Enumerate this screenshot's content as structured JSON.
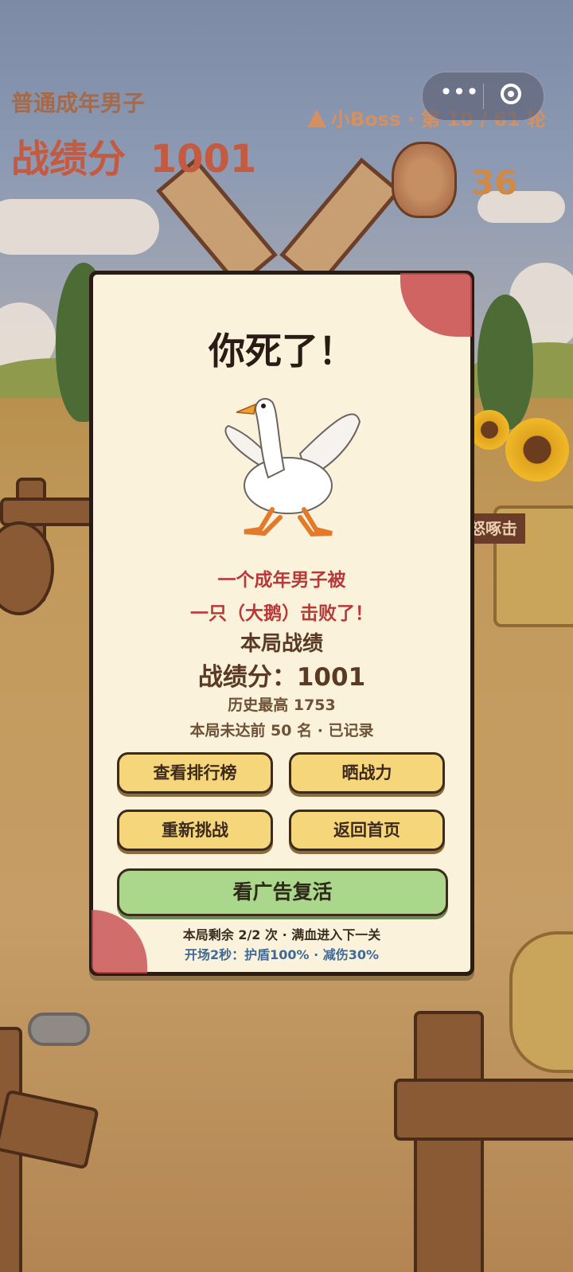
{
  "hud": {
    "player_title": "普通成年男子",
    "score_label": "战绩分",
    "score_value": "1001",
    "round_text": "小Boss · 第 10 / 61 轮",
    "coin_count": "36",
    "side_tag": "怒啄击"
  },
  "capsule": {
    "more_glyph": "•••"
  },
  "dialog": {
    "title": "你死了！",
    "line1": "一个成年男子被",
    "line2": "一只（大鹅）击败了！",
    "section_title": "本局战绩",
    "score_line": "战绩分：1001",
    "best_line": "历史最高 1753",
    "rank_line": "本局未达前 50 名 · 已记录",
    "buttons": {
      "leaderboard": "查看排行榜",
      "share": "晒战力",
      "retry": "重新挑战",
      "home": "返回首页",
      "revive": "看广告复活"
    },
    "note1": "本局剩余 2/2 次 · 满血进入下一关",
    "note2": "开场2秒：护盾100% · 减伤30%"
  },
  "colors": {
    "panel_bg": "#fbf2dc",
    "button_yellow": "#f6d67b",
    "button_green": "#abd78c",
    "defeat_red": "#b8393a",
    "note_blue": "#3f6a98"
  }
}
